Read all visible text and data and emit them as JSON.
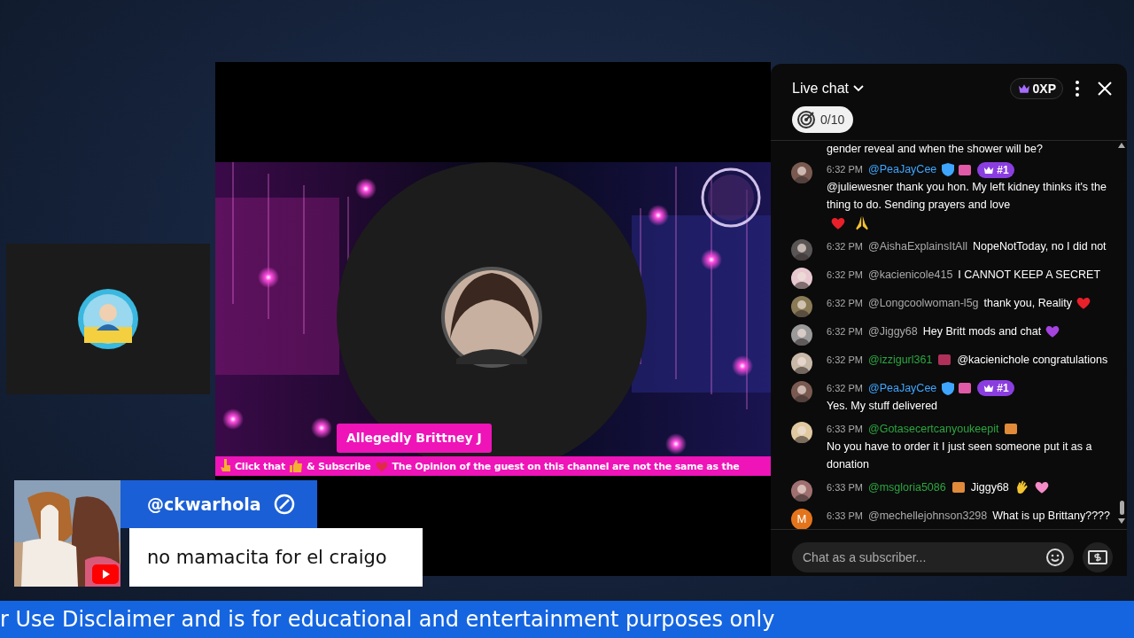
{
  "stage": {
    "name_tag": "Allegedly Brittney J",
    "ticker": [
      {
        "kind": "point"
      },
      {
        "kind": "text",
        "text": "Click that"
      },
      {
        "kind": "thumb"
      },
      {
        "kind": "text",
        "text": "& Subscribe"
      },
      {
        "kind": "heart"
      },
      {
        "kind": "text",
        "text": "The Opinion of the guest on this channel are not the same as the"
      }
    ]
  },
  "chat": {
    "title": "Live chat",
    "xp": "0XP",
    "goal": "0/10",
    "cut_line": "gender reveal and when the shower will be?",
    "messages": [
      {
        "avatar": {
          "kind": "picture"
        },
        "time": "6:32 PM",
        "author": "@PeaJayCee",
        "color": "#3ea6ff",
        "badges": [
          {
            "kind": "verified"
          },
          {
            "kind": "sticker",
            "color": "#e05aa8"
          },
          {
            "kind": "rank",
            "label": "#1"
          }
        ],
        "text": "@juliewesner thank you hon. My left kidney thinks it's the thing to do. Sending prayers and love",
        "emojis": [
          {
            "kind": "heart",
            "color": "#e8202a"
          },
          {
            "kind": "pray"
          }
        ]
      },
      {
        "avatar": {
          "kind": "picture"
        },
        "time": "6:32 PM",
        "author": "@AishaExplainsItAll",
        "color": "#aaaaaa",
        "text": "NopeNotToday, no I did not"
      },
      {
        "avatar": {
          "kind": "picture"
        },
        "time": "6:32 PM",
        "author": "@kacienicole415",
        "color": "#aaaaaa",
        "text": "I CANNOT KEEP A SECRET"
      },
      {
        "avatar": {
          "kind": "picture"
        },
        "time": "6:32 PM",
        "author": "@Longcoolwoman-l5g",
        "color": "#aaaaaa",
        "text": "thank you, Reality",
        "emojis": [
          {
            "kind": "heart",
            "color": "#e8202a"
          }
        ]
      },
      {
        "avatar": {
          "kind": "picture"
        },
        "time": "6:32 PM",
        "author": "@Jiggy68",
        "color": "#aaaaaa",
        "text": "Hey Britt mods and chat",
        "emojis": [
          {
            "kind": "heart",
            "color": "#a443e0"
          }
        ]
      },
      {
        "avatar": {
          "kind": "picture"
        },
        "time": "6:32 PM",
        "author": "@izzigurl361",
        "color": "#2ba640",
        "badges": [
          {
            "kind": "sticker",
            "color": "#b0305a"
          }
        ],
        "text": "@kacienichole congratulations"
      },
      {
        "avatar": {
          "kind": "picture"
        },
        "time": "6:32 PM",
        "author": "@PeaJayCee",
        "color": "#3ea6ff",
        "badges": [
          {
            "kind": "verified"
          },
          {
            "kind": "sticker",
            "color": "#e05aa8"
          },
          {
            "kind": "rank",
            "label": "#1"
          }
        ],
        "text": "Yes. My stuff delivered"
      },
      {
        "avatar": {
          "kind": "picture"
        },
        "time": "6:33 PM",
        "author": "@Gotasecertcanyoukeepit",
        "color": "#2ba640",
        "badges": [
          {
            "kind": "sticker",
            "color": "#e08a3a"
          }
        ],
        "text": "No you have to order it I just seen someone put it as a donation"
      },
      {
        "avatar": {
          "kind": "picture"
        },
        "time": "6:33 PM",
        "author": "@msgloria5086",
        "color": "#2ba640",
        "badges": [
          {
            "kind": "sticker",
            "color": "#e08a3a"
          }
        ],
        "text": "Jiggy68",
        "emojis": [
          {
            "kind": "wave"
          },
          {
            "kind": "heart",
            "color": "#f58ac8"
          }
        ]
      },
      {
        "avatar": {
          "kind": "letter",
          "letter": "M"
        },
        "time": "6:33 PM",
        "author": "@mechellejohnson3298",
        "color": "#aaaaaa",
        "text": "What is up Brittany????"
      }
    ],
    "input": {
      "placeholder": "Chat as a subscriber..."
    }
  },
  "comment": {
    "author": "@ckwarhola",
    "text": "no mamacita for el craigo"
  },
  "bottom_banner": "r Use Disclaimer and is for educational and entertainment purposes only"
}
